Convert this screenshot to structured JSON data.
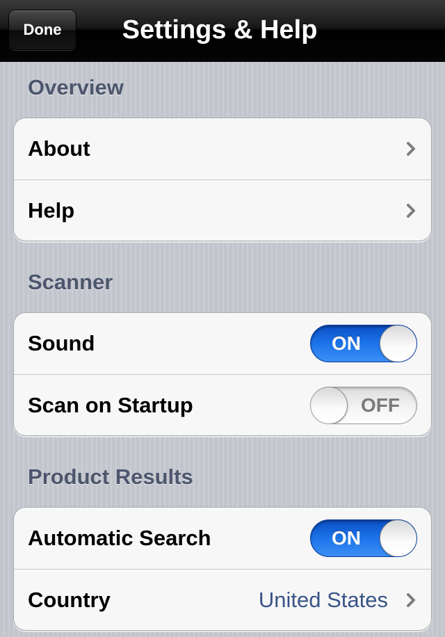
{
  "navbar": {
    "done_label": "Done",
    "title": "Settings & Help"
  },
  "sections": {
    "overview": {
      "header": "Overview",
      "about_label": "About",
      "help_label": "Help"
    },
    "scanner": {
      "header": "Scanner",
      "sound_label": "Sound",
      "sound_state": "ON",
      "scan_on_startup_label": "Scan on Startup",
      "scan_on_startup_state": "OFF"
    },
    "product_results": {
      "header": "Product Results",
      "automatic_search_label": "Automatic Search",
      "automatic_search_state": "ON",
      "country_label": "Country",
      "country_value": "United States"
    }
  },
  "colors": {
    "navbar": "#000000",
    "toggle_on": "#1d74ea",
    "section_header_text": "#4c566c",
    "detail_value_text": "#385487"
  },
  "icons": {
    "disclosure": "chevron-right-icon"
  }
}
